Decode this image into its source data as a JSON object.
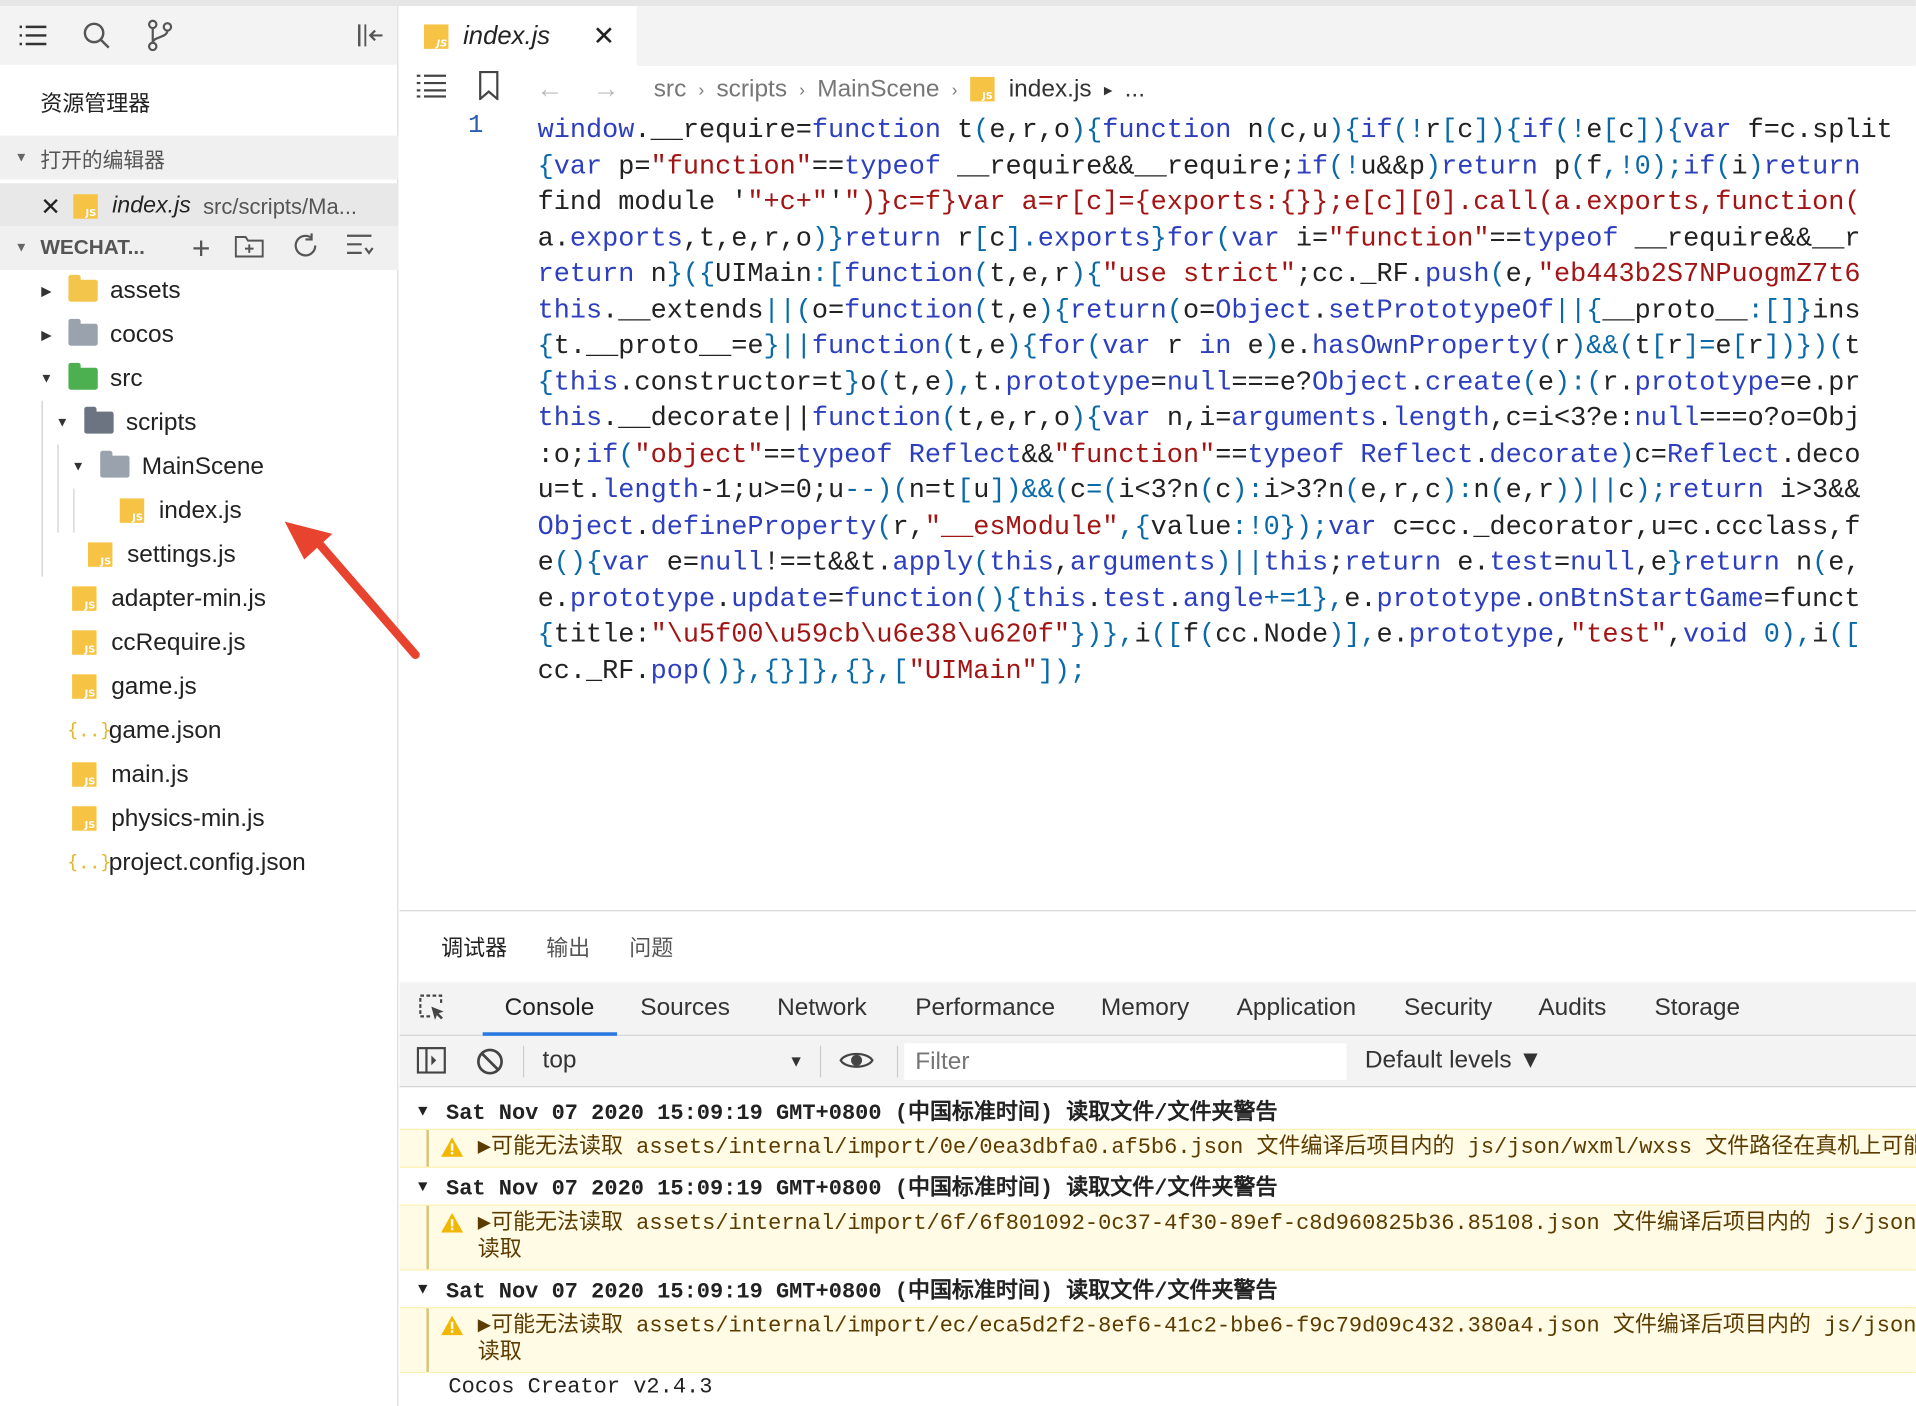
{
  "sidebar": {
    "title": "资源管理器",
    "open_editors_label": "打开的编辑器",
    "open_file": {
      "name": "index.js",
      "path": "src/scripts/Ma..."
    },
    "project_label": "WECHAT...",
    "tree": [
      {
        "label": "assets",
        "type": "folder-yellow",
        "expanded": false
      },
      {
        "label": "cocos",
        "type": "folder",
        "expanded": false
      },
      {
        "label": "src",
        "type": "folder-green",
        "expanded": true
      },
      {
        "label": "scripts",
        "type": "folder-dark",
        "expanded": true
      },
      {
        "label": "MainScene",
        "type": "folder",
        "expanded": true
      },
      {
        "label": "index.js",
        "type": "js"
      },
      {
        "label": "settings.js",
        "type": "js"
      },
      {
        "label": "adapter-min.js",
        "type": "js"
      },
      {
        "label": "ccRequire.js",
        "type": "js"
      },
      {
        "label": "game.js",
        "type": "js"
      },
      {
        "label": "game.json",
        "type": "json"
      },
      {
        "label": "main.js",
        "type": "js"
      },
      {
        "label": "physics-min.js",
        "type": "js"
      },
      {
        "label": "project.config.json",
        "type": "json"
      }
    ]
  },
  "editor": {
    "tab_label": "index.js",
    "breadcrumb": [
      "src",
      "scripts",
      "MainScene",
      "index.js",
      "..."
    ],
    "line_number": "1",
    "code_lines": [
      "window.__require=function t(e,r,o){function n(c,u){if(!r[c]){if(!e[c]){var f=c.split",
      "{var p=\"function\"==typeof __require&&__require;if(!u&&p)return p(f,!0);if(i)return",
      "find module '\"+c+\"'\")}c=f}var a=r[c]={exports:{}};e[c][0].call(a.exports,function(",
      "a.exports,t,e,r,o)}return r[c].exports}for(var i=\"function\"==typeof __require&&__r",
      "return n}({UIMain:[function(t,e,r){\"use strict\";cc._RF.push(e,\"eb443b2S7NPuogmZ7t6",
      "this.__extends||(o=function(t,e){return(o=Object.setPrototypeOf||{__proto__:[]}ins",
      "{t.__proto__=e}||function(t,e){for(var r in e)e.hasOwnProperty(r)&&(t[r]=e[r])})(t",
      "{this.constructor=t}o(t,e),t.prototype=null===e?Object.create(e):(r.prototype=e.pr",
      "this.__decorate||function(t,e,r,o){var n,i=arguments.length,c=i<3?e:null===o?o=Obj",
      ":o;if(\"object\"==typeof Reflect&&\"function\"==typeof Reflect.decorate)c=Reflect.deco",
      "u=t.length-1;u>=0;u--)(n=t[u])&&(c=(i<3?n(c):i>3?n(e,r,c):n(e,r))||c);return i>3&&",
      "Object.defineProperty(r,\"__esModule\",{value:!0});var c=cc._decorator,u=c.ccclass,f",
      "e(){var e=null!==t&&t.apply(this,arguments)||this;return e.test=null,e}return n(e,",
      "e.prototype.update=function(){this.test.angle+=1},e.prototype.onBtnStartGame=funct",
      "{title:\"\\u5f00\\u59cb\\u6e38\\u620f\"})},i([f(cc.Node)],e.prototype,\"test\",void 0),i([",
      "cc._RF.pop()},{}]},{},[\"UIMain\"]);"
    ]
  },
  "panel": {
    "tabs": [
      "调试器",
      "输出",
      "问题"
    ],
    "devtools_tabs": [
      "Console",
      "Sources",
      "Network",
      "Performance",
      "Memory",
      "Application",
      "Security",
      "Audits",
      "Storage"
    ],
    "context": "top",
    "filter_placeholder": "Filter",
    "levels": "Default levels ▼",
    "logs": [
      {
        "header": "Sat Nov 07 2020 15:09:19 GMT+0800 (中国标准时间) 读取文件/文件夹警告",
        "warning": "▶可能无法读取 assets/internal/import/0e/0ea3dbfa0.af5b6.json 文件编译后项目内的 js/json/wxml/wxss 文件路径在真机上可能"
      },
      {
        "header": "Sat Nov 07 2020 15:09:19 GMT+0800 (中国标准时间) 读取文件/文件夹警告",
        "warning": "▶可能无法读取 assets/internal/import/6f/6f801092-0c37-4f30-89ef-c8d960825b36.85108.json 文件编译后项目内的 js/json\n读取"
      },
      {
        "header": "Sat Nov 07 2020 15:09:19 GMT+0800 (中国标准时间) 读取文件/文件夹警告",
        "warning": "▶可能无法读取 assets/internal/import/ec/eca5d2f2-8ef6-41c2-bbe6-f9c79d09c432.380a4.json 文件编译后项目内的 js/json\n读取"
      }
    ],
    "version": "Cocos Creator v2.4.3"
  },
  "colors": {
    "accent": "#2a7ae2",
    "warning_bg": "#fffbe5",
    "arrow": "#e8432f",
    "js_badge": "#f6c344"
  }
}
